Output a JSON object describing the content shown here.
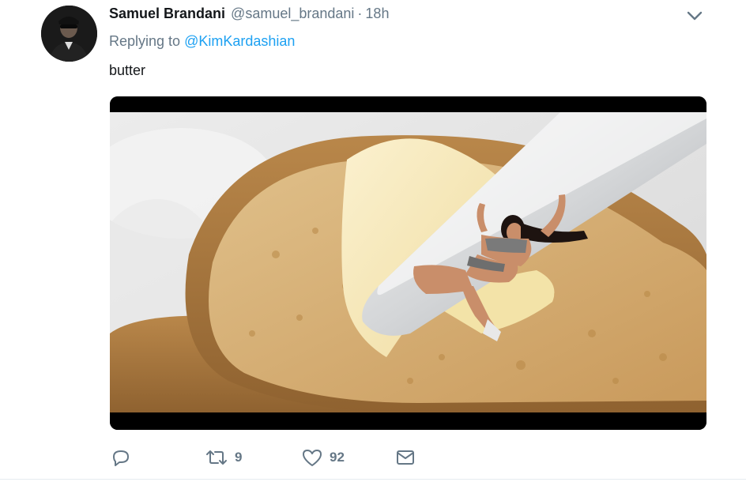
{
  "tweet": {
    "author": {
      "display_name": "Samuel Brandani",
      "handle": "@samuel_brandani",
      "avatar_icon": "user-avatar"
    },
    "separator": "·",
    "timestamp": "18h",
    "reply_prefix": "Replying to ",
    "reply_to": "@KimKardashian",
    "text": "butter",
    "media": {
      "type": "image"
    },
    "actions": {
      "reply": {
        "icon": "reply-icon",
        "count": ""
      },
      "retweet": {
        "icon": "retweet-icon",
        "count": "9"
      },
      "like": {
        "icon": "heart-icon",
        "count": "92"
      },
      "message": {
        "icon": "envelope-icon",
        "count": ""
      }
    },
    "menu_icon": "chevron-down-icon"
  },
  "colors": {
    "text": "#14171a",
    "secondary": "#657786",
    "link": "#1da1f2",
    "divider": "#e6ecf0"
  }
}
